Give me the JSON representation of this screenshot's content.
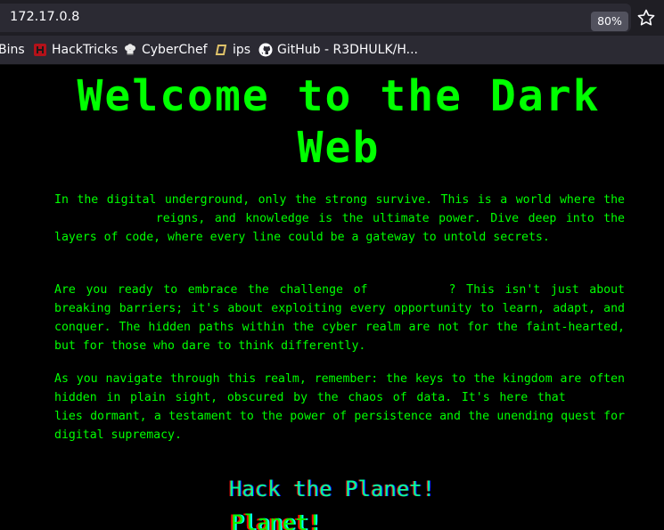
{
  "browser": {
    "url": "172.17.0.8",
    "zoom": "80%",
    "bookmarks": [
      {
        "label": "Bins",
        "icon": "none"
      },
      {
        "label": "HackTricks",
        "icon": "hacktricks-icon"
      },
      {
        "label": "CyberChef",
        "icon": "chef-hat-icon"
      },
      {
        "label": "ips",
        "icon": "ips-icon"
      },
      {
        "label": "GitHub - R3DHULK/H...",
        "icon": "github-icon"
      }
    ]
  },
  "page": {
    "title": "Welcome to the Dark Web",
    "p1_a": "In the digital underground, only the strong survive. This is a world where the ",
    "p1_b": " reigns, and knowledge is the ultimate power. Dive deep into the layers of code, where every line could be a gateway to untold secrets.",
    "p2_a": "Are you ready to embrace the challenge of ",
    "p2_b": "? This isn't just about breaking barriers; it's about exploiting every opportunity to learn, adapt, and conquer. The hidden paths within the cyber realm are not for the faint-hearted, but for those who dare to think differently.",
    "p3_a": "As you navigate through this realm, remember: the keys to the kingdom are often hidden in plain sight, obscured by the chaos of data. It's here that ",
    "p3_b": " lies dormant, a testament to the power of persistence and the unending quest for digital supremacy.",
    "hack_line1": "Hack the Planet!",
    "hack_line2": "Planet!"
  },
  "colors": {
    "text": "#00ff00",
    "background": "#000000",
    "toolbar": "#2b2a33"
  }
}
